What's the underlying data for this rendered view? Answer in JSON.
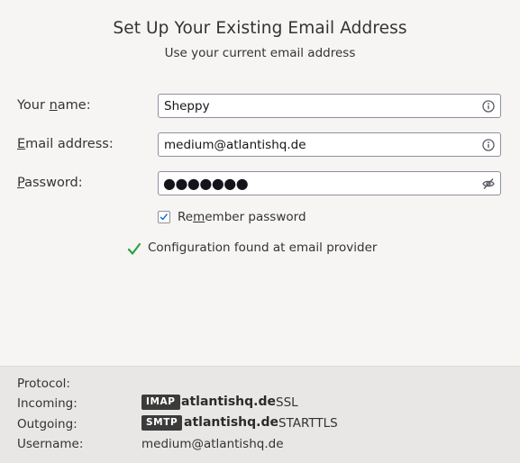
{
  "header": {
    "title": "Set Up Your Existing Email Address",
    "subtitle": "Use your current email address"
  },
  "form": {
    "name": {
      "label_pre": "Your ",
      "label_key": "n",
      "label_post": "ame:",
      "value": "Sheppy",
      "icon": "info-icon"
    },
    "email": {
      "label_pre": "",
      "label_key": "E",
      "label_post": "mail address:",
      "value": "medium@atlantishq.de",
      "icon": "info-icon"
    },
    "password": {
      "label_pre": "",
      "label_key": "P",
      "label_post": "assword:",
      "value": "●●●●●●●",
      "icon": "eye-slash-icon"
    },
    "remember": {
      "label_pre": "Re",
      "label_key": "m",
      "label_post": "ember password",
      "checked": true
    }
  },
  "status": {
    "message": "Configuration found at email provider",
    "icon": "checkmark-icon",
    "color": "#2ea043"
  },
  "config": {
    "protocol_label": "Protocol:",
    "incoming_label": "Incoming:",
    "outgoing_label": "Outgoing:",
    "username_label": "Username:",
    "incoming": {
      "badge": "IMAP",
      "host": "atlantishq.de",
      "security": "SSL"
    },
    "outgoing": {
      "badge": "SMTP",
      "host": "atlantishq.de",
      "security": "STARTTLS"
    },
    "username": "medium@atlantishq.de"
  }
}
